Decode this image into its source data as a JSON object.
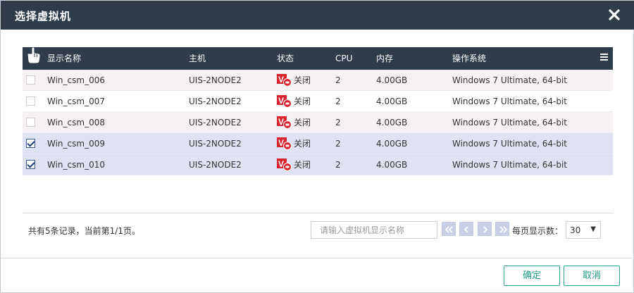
{
  "dialog": {
    "title": "选择虚拟机"
  },
  "table": {
    "headers": {
      "name": "显示名称",
      "host": "主机",
      "state": "状态",
      "cpu": "CPU",
      "memory": "内存",
      "os": "操作系统"
    },
    "rows": [
      {
        "checked": false,
        "name": "Win_csm_006",
        "host": "UIS-2NODE2",
        "state": "关闭",
        "cpu": "2",
        "memory": "4.00GB",
        "os": "Windows 7 Ultimate, 64-bit"
      },
      {
        "checked": false,
        "name": "Win_csm_007",
        "host": "UIS-2NODE2",
        "state": "关闭",
        "cpu": "2",
        "memory": "4.00GB",
        "os": "Windows 7 Ultimate, 64-bit"
      },
      {
        "checked": false,
        "name": "Win_csm_008",
        "host": "UIS-2NODE2",
        "state": "关闭",
        "cpu": "2",
        "memory": "4.00GB",
        "os": "Windows 7 Ultimate, 64-bit"
      },
      {
        "checked": true,
        "name": "Win_csm_009",
        "host": "UIS-2NODE2",
        "state": "关闭",
        "cpu": "2",
        "memory": "4.00GB",
        "os": "Windows 7 Ultimate, 64-bit"
      },
      {
        "checked": true,
        "name": "Win_csm_010",
        "host": "UIS-2NODE2",
        "state": "关闭",
        "cpu": "2",
        "memory": "4.00GB",
        "os": "Windows 7 Ultimate, 64-bit"
      }
    ]
  },
  "pagination": {
    "records_text": "共有5条记录，当前第1/1页。",
    "search_placeholder": "请输入虚拟机显示名称",
    "page_size_label": "每页显示数：",
    "page_size": "30"
  },
  "buttons": {
    "confirm": "确定",
    "cancel": "取消"
  },
  "colors": {
    "titlebar": "#2f3c4c",
    "selected_row": "#dee2f2",
    "accent": "#1f9c80",
    "status_off": "#d9232d"
  }
}
